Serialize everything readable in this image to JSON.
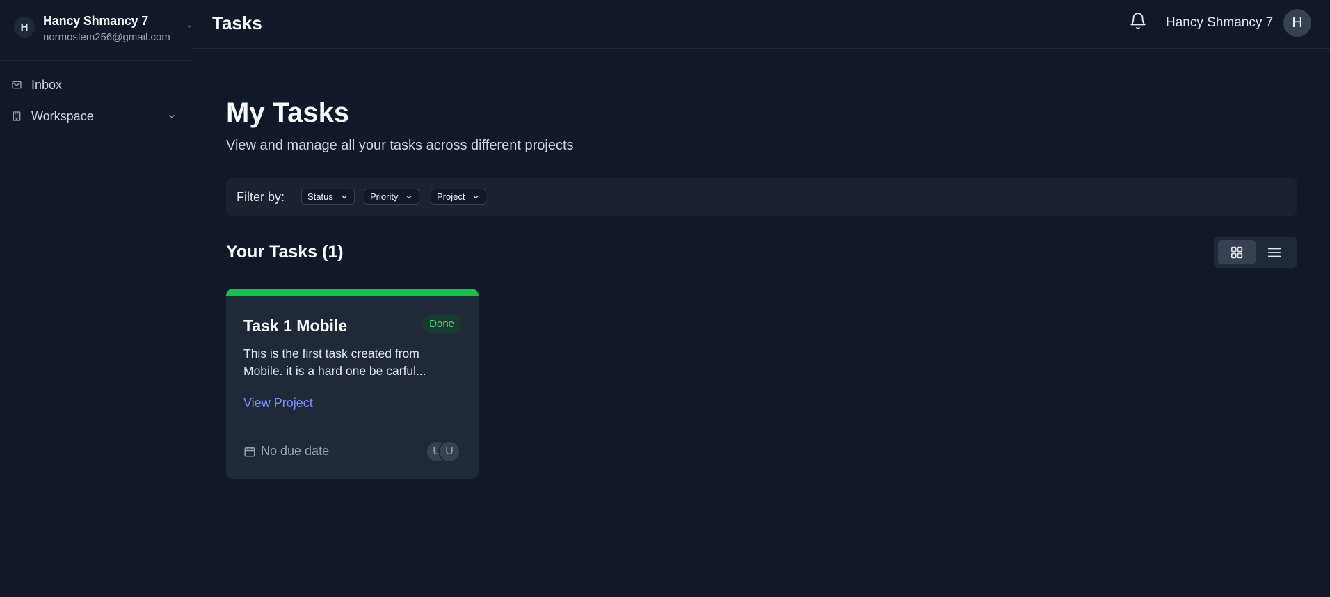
{
  "sidebar": {
    "account": {
      "avatar_initial": "H",
      "name": "Hancy Shmancy 7",
      "email": "normoslem256@gmail.com"
    },
    "items": [
      {
        "label": "Inbox",
        "icon": "mail-icon"
      },
      {
        "label": "Workspace",
        "icon": "building-icon",
        "expandable": true
      }
    ]
  },
  "header": {
    "title": "Tasks",
    "user_name": "Hancy Shmancy 7",
    "avatar_initial": "H"
  },
  "main": {
    "title": "My Tasks",
    "subtitle": "View and manage all your tasks across different projects",
    "filters": {
      "label": "Filter by:",
      "options": [
        "Status",
        "Priority",
        "Project"
      ]
    },
    "tasks_heading": "Your Tasks (1)",
    "view_toggle": {
      "selected": "grid"
    },
    "tasks": [
      {
        "title": "Task 1 Mobile",
        "status": "Done",
        "status_color": "#10c24f",
        "description": "This is the first task created from Mobile. it is a hard one be carful...",
        "link_label": "View Project",
        "due": "No due date",
        "assignees": [
          "U",
          "U"
        ]
      }
    ]
  },
  "colors": {
    "background": "#111827",
    "card": "#1f2937",
    "accent_link": "#818cf8",
    "done_green": "#10c24f"
  }
}
